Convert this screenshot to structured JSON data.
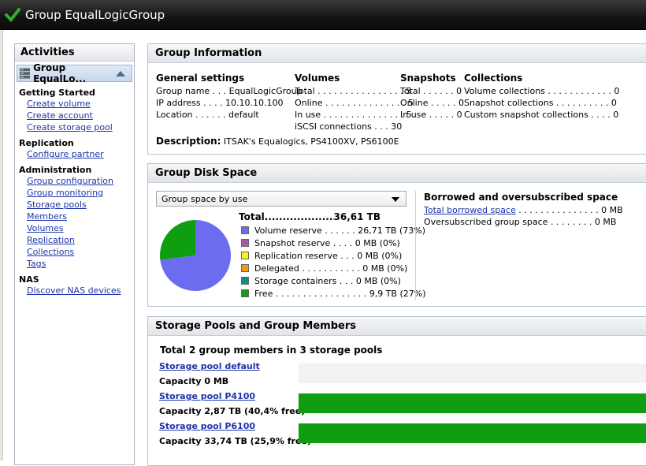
{
  "window": {
    "title": "Group EqualLogicGroup"
  },
  "activities": {
    "header": "Activities",
    "group_selector": "Group EqualLo...",
    "sections": [
      {
        "title": "Getting Started",
        "links": [
          "Create volume",
          "Create account",
          "Create storage pool"
        ]
      },
      {
        "title": "Replication",
        "links": [
          "Configure partner"
        ]
      },
      {
        "title": "Administration",
        "links": [
          "Group configuration",
          "Group monitoring",
          "Storage pools",
          "Members",
          "Volumes",
          "Replication",
          "Collections",
          "Tags"
        ]
      },
      {
        "title": "NAS",
        "links": [
          "Discover NAS devices"
        ]
      }
    ]
  },
  "group_info": {
    "header": "Group Information",
    "general": {
      "title": "General settings",
      "rows": [
        "Group name . . . EqualLogicGroup",
        "IP address . . . . 10.10.10.100",
        "Location . . . . . . default"
      ]
    },
    "volumes": {
      "title": "Volumes",
      "rows": [
        "Total . . . . . . . . . . . . . . . . 5",
        "Online . . . . . . . . . . . . . . . 5",
        "In use . . . . . . . . . . . . . . . 5",
        "iSCSI connections . . . 30"
      ]
    },
    "snapshots": {
      "title": "Snapshots",
      "rows": [
        "Total . . . . . . 0",
        "Online . . . . . 0",
        "In use . . . . . 0"
      ]
    },
    "collections": {
      "title": "Collections",
      "rows": [
        "Volume collections . . . . . . . . . . . . 0",
        "Snapshot collections . . . . . . . . . . 0",
        "Custom snapshot collections . . . . 0"
      ]
    },
    "description_label": "Description:",
    "description": "ITSAK's Equalogics, PS4100XV, PS6100E"
  },
  "disk_space": {
    "header": "Group Disk Space",
    "dropdown": "Group space by use",
    "total_label": "Total",
    "total_value": "36,61 TB",
    "legend": [
      {
        "label": "Volume reserve . . . . . . 26,71 TB (73%)",
        "color": "#6b6cf0",
        "fraction": 0.73
      },
      {
        "label": "Snapshot reserve . . . . 0 MB (0%)",
        "color": "#a45ba8",
        "fraction": 0
      },
      {
        "label": "Replication reserve . . . 0 MB (0%)",
        "color": "#f5f51a",
        "fraction": 0
      },
      {
        "label": "Delegated . . . . . . . . . . . 0 MB (0%)",
        "color": "#f59a0c",
        "fraction": 0
      },
      {
        "label": "Storage containers . . . 0 MB (0%)",
        "color": "#138c8c",
        "fraction": 0
      },
      {
        "label": "Free . . . . . . . . . . . . . . . . . 9,9 TB (27%)",
        "color": "#0f9e10",
        "fraction": 0.27
      }
    ],
    "borrowed": {
      "title": "Borrowed and oversubscribed space",
      "borrowed_link": "Total borrowed space",
      "borrowed_value": ". . . . . . . . . . . . . . . 0 MB",
      "oversub_label": "Oversubscribed group space",
      "oversub_value": ". . . . . . . . 0 MB"
    }
  },
  "pools": {
    "header": "Storage Pools and Group Members",
    "total": "Total 2 group members in 3 storage pools",
    "items": [
      {
        "name": "Storage pool default",
        "capacity": "Capacity 0 MB",
        "used_fraction": 0
      },
      {
        "name": "Storage pool P4100",
        "capacity": "Capacity 2,87 TB (40,4% free)",
        "used_fraction": 1
      },
      {
        "name": "Storage pool P6100",
        "capacity": "Capacity 33,74 TB (25,9% free)",
        "used_fraction": 1
      }
    ]
  }
}
